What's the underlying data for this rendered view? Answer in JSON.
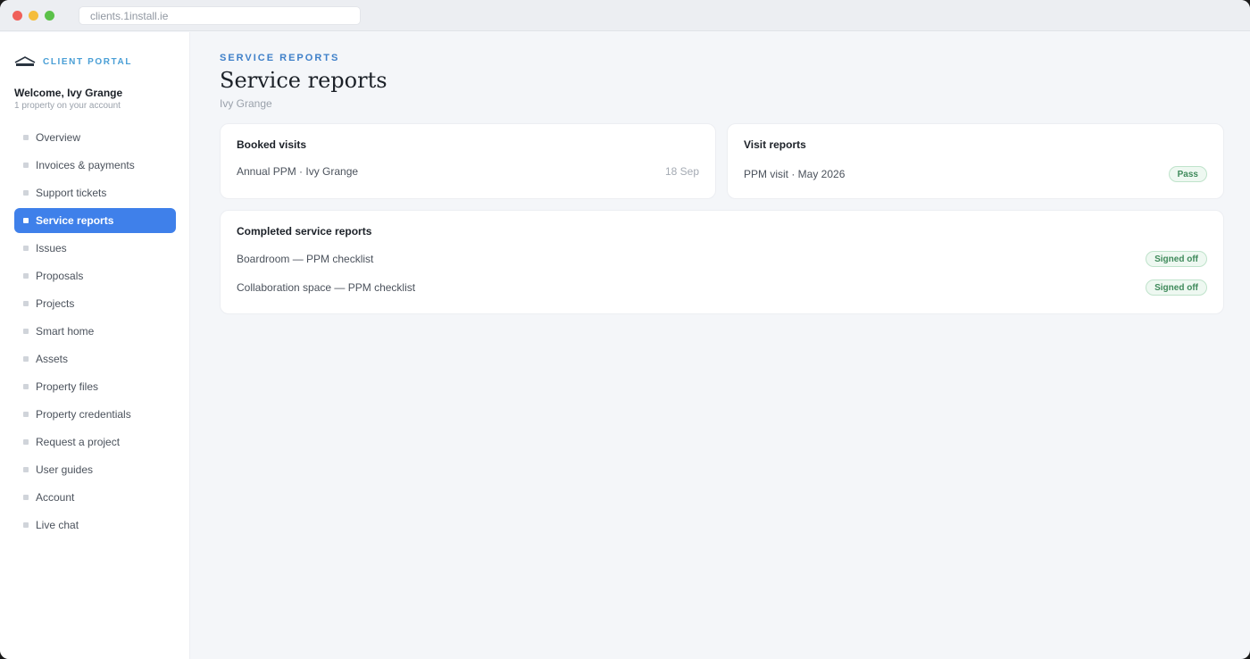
{
  "browser": {
    "url": "clients.1install.ie"
  },
  "sidebar": {
    "brand": "CLIENT PORTAL",
    "welcome": "Welcome, Ivy Grange",
    "welcome_sub": "1 property on your account",
    "items": [
      {
        "label": "Overview"
      },
      {
        "label": "Invoices & payments"
      },
      {
        "label": "Support tickets"
      },
      {
        "label": "Service reports",
        "active": true
      },
      {
        "label": "Issues"
      },
      {
        "label": "Proposals"
      },
      {
        "label": "Projects"
      },
      {
        "label": "Smart home"
      },
      {
        "label": "Assets"
      },
      {
        "label": "Property files"
      },
      {
        "label": "Property credentials"
      },
      {
        "label": "Request a project"
      },
      {
        "label": "User guides"
      },
      {
        "label": "Account"
      },
      {
        "label": "Live chat"
      }
    ]
  },
  "header": {
    "eyebrow": "SERVICE REPORTS",
    "title": "Service reports",
    "subtitle": "Ivy Grange"
  },
  "booked": {
    "title": "Booked visits",
    "items": [
      {
        "label": "Annual PPM · Ivy Grange",
        "date": "18 Sep"
      }
    ]
  },
  "visits": {
    "title": "Visit reports",
    "items": [
      {
        "label": "PPM visit · May 2026",
        "status": "Pass"
      }
    ]
  },
  "completed": {
    "title": "Completed service reports",
    "items": [
      {
        "label": "Boardroom — PPM checklist",
        "status": "Signed off"
      },
      {
        "label": "Collaboration space — PPM checklist",
        "status": "Signed off"
      }
    ]
  },
  "colors": {
    "accent": "#3f80ea",
    "brand": "#4a9fd6",
    "success": "#3f8a5b"
  }
}
